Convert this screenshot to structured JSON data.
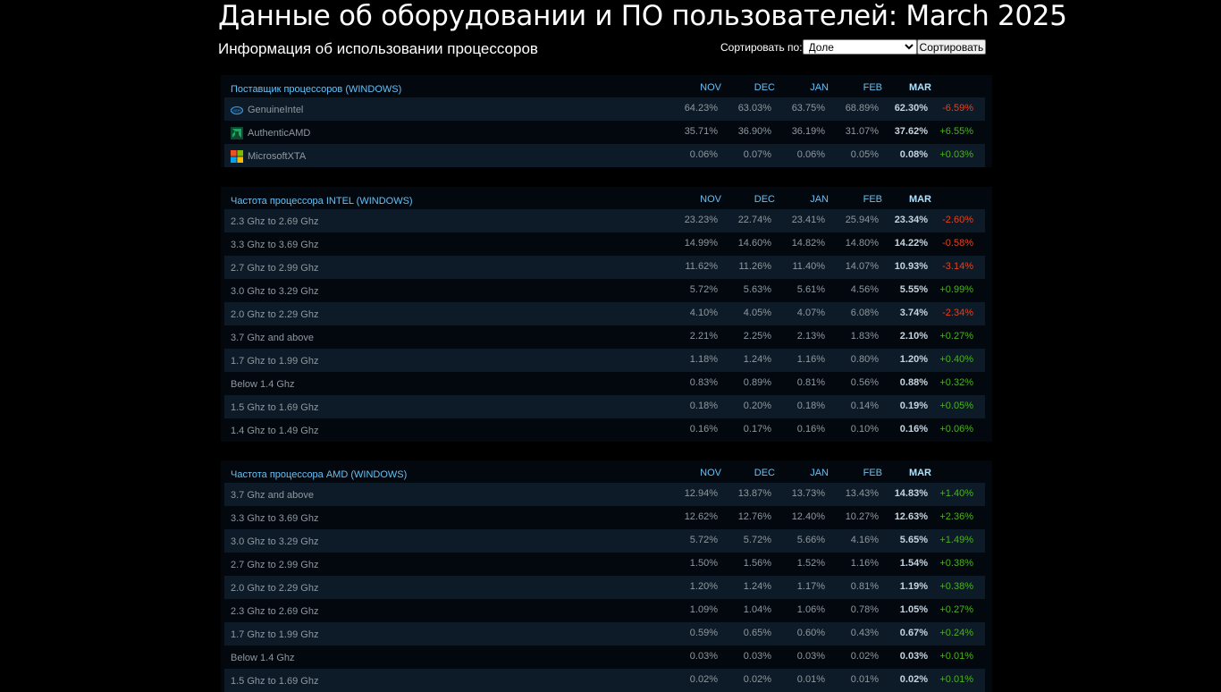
{
  "header": {
    "title": "Данные об оборудовании и ПО пользователей: March 2025",
    "subtitle": "Информация об использовании процессоров",
    "sort_label": "Сортировать по:",
    "sort_selected": "Доле",
    "sort_button": "Сортировать"
  },
  "months": [
    "NOV",
    "DEC",
    "JAN",
    "FEB",
    "MAR"
  ],
  "sections": [
    {
      "title": "Поставщик процессоров (WINDOWS)",
      "rows": [
        {
          "label": "GenuineIntel",
          "icon": "intel-logo-icon",
          "values": [
            "64.23%",
            "63.03%",
            "63.75%",
            "68.89%",
            "62.30%"
          ],
          "change": "-6.59%"
        },
        {
          "label": "AuthenticAMD",
          "icon": "amd-logo-icon",
          "values": [
            "35.71%",
            "36.90%",
            "36.19%",
            "31.07%",
            "37.62%"
          ],
          "change": "+6.55%"
        },
        {
          "label": "MicrosoftXTA",
          "icon": "microsoft-logo-icon",
          "values": [
            "0.06%",
            "0.07%",
            "0.06%",
            "0.05%",
            "0.08%"
          ],
          "change": "+0.03%"
        }
      ]
    },
    {
      "title": "Частота процессора INTEL (WINDOWS)",
      "rows": [
        {
          "label": "2.3 Ghz to 2.69 Ghz",
          "values": [
            "23.23%",
            "22.74%",
            "23.41%",
            "25.94%",
            "23.34%"
          ],
          "change": "-2.60%"
        },
        {
          "label": "3.3 Ghz to 3.69 Ghz",
          "values": [
            "14.99%",
            "14.60%",
            "14.82%",
            "14.80%",
            "14.22%"
          ],
          "change": "-0.58%"
        },
        {
          "label": "2.7 Ghz to 2.99 Ghz",
          "values": [
            "11.62%",
            "11.26%",
            "11.40%",
            "14.07%",
            "10.93%"
          ],
          "change": "-3.14%"
        },
        {
          "label": "3.0 Ghz to 3.29 Ghz",
          "values": [
            "5.72%",
            "5.63%",
            "5.61%",
            "4.56%",
            "5.55%"
          ],
          "change": "+0.99%"
        },
        {
          "label": "2.0 Ghz to 2.29 Ghz",
          "values": [
            "4.10%",
            "4.05%",
            "4.07%",
            "6.08%",
            "3.74%"
          ],
          "change": "-2.34%"
        },
        {
          "label": "3.7 Ghz and above",
          "values": [
            "2.21%",
            "2.25%",
            "2.13%",
            "1.83%",
            "2.10%"
          ],
          "change": "+0.27%"
        },
        {
          "label": "1.7 Ghz to 1.99 Ghz",
          "values": [
            "1.18%",
            "1.24%",
            "1.16%",
            "0.80%",
            "1.20%"
          ],
          "change": "+0.40%"
        },
        {
          "label": "Below 1.4 Ghz",
          "values": [
            "0.83%",
            "0.89%",
            "0.81%",
            "0.56%",
            "0.88%"
          ],
          "change": "+0.32%"
        },
        {
          "label": "1.5 Ghz to 1.69 Ghz",
          "values": [
            "0.18%",
            "0.20%",
            "0.18%",
            "0.14%",
            "0.19%"
          ],
          "change": "+0.05%"
        },
        {
          "label": "1.4 Ghz to 1.49 Ghz",
          "values": [
            "0.16%",
            "0.17%",
            "0.16%",
            "0.10%",
            "0.16%"
          ],
          "change": "+0.06%"
        }
      ]
    },
    {
      "title": "Частота процессора AMD (WINDOWS)",
      "rows": [
        {
          "label": "3.7 Ghz and above",
          "values": [
            "12.94%",
            "13.87%",
            "13.73%",
            "13.43%",
            "14.83%"
          ],
          "change": "+1.40%"
        },
        {
          "label": "3.3 Ghz to 3.69 Ghz",
          "values": [
            "12.62%",
            "12.76%",
            "12.40%",
            "10.27%",
            "12.63%"
          ],
          "change": "+2.36%"
        },
        {
          "label": "3.0 Ghz to 3.29 Ghz",
          "values": [
            "5.72%",
            "5.72%",
            "5.66%",
            "4.16%",
            "5.65%"
          ],
          "change": "+1.49%"
        },
        {
          "label": "2.7 Ghz to 2.99 Ghz",
          "values": [
            "1.50%",
            "1.56%",
            "1.52%",
            "1.16%",
            "1.54%"
          ],
          "change": "+0.38%"
        },
        {
          "label": "2.0 Ghz to 2.29 Ghz",
          "values": [
            "1.20%",
            "1.24%",
            "1.17%",
            "0.81%",
            "1.19%"
          ],
          "change": "+0.38%"
        },
        {
          "label": "2.3 Ghz to 2.69 Ghz",
          "values": [
            "1.09%",
            "1.04%",
            "1.06%",
            "0.78%",
            "1.05%"
          ],
          "change": "+0.27%"
        },
        {
          "label": "1.7 Ghz to 1.99 Ghz",
          "values": [
            "0.59%",
            "0.65%",
            "0.60%",
            "0.43%",
            "0.67%"
          ],
          "change": "+0.24%"
        },
        {
          "label": "Below 1.4 Ghz",
          "values": [
            "0.03%",
            "0.03%",
            "0.03%",
            "0.02%",
            "0.03%"
          ],
          "change": "+0.01%"
        },
        {
          "label": "1.5 Ghz to 1.69 Ghz",
          "values": [
            "0.02%",
            "0.02%",
            "0.01%",
            "0.01%",
            "0.02%"
          ],
          "change": "+0.01%"
        }
      ]
    }
  ],
  "colors": {
    "background": "#000000",
    "panel": "#02080e",
    "row_alt": "#0c1b27",
    "accent": "#66c0f4",
    "positive": "#4cb31a",
    "negative": "#e5411e"
  }
}
